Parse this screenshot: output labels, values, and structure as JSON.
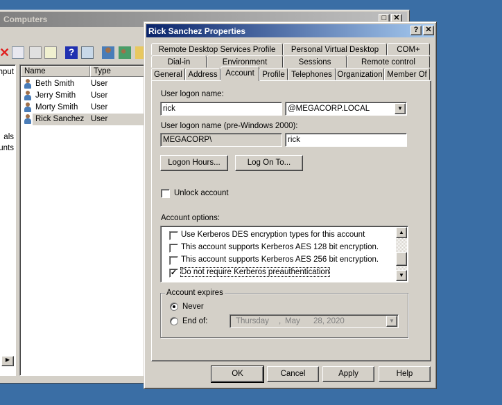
{
  "background_window": {
    "title": "Computers",
    "tree_items": [
      "nput",
      "als",
      "unts"
    ],
    "list_headers": [
      "Name",
      "Type"
    ],
    "rows": [
      {
        "name": "Beth Smith",
        "type": "User"
      },
      {
        "name": "Jerry Smith",
        "type": "User"
      },
      {
        "name": "Morty Smith",
        "type": "User"
      },
      {
        "name": "Rick Sanchez",
        "type": "User",
        "selected": true
      }
    ],
    "toolbar_icons": [
      "delete-icon",
      "properties-icon",
      "refresh-icon",
      "export-icon",
      "help-icon",
      "console-icon",
      "new-user-icon",
      "new-group-icon",
      "new-ou-icon"
    ]
  },
  "dialog": {
    "title": "Rick Sanchez Properties",
    "help_label": "?",
    "close_label": "✕",
    "tabs_row1": [
      "Remote Desktop Services Profile",
      "Personal Virtual Desktop",
      "COM+"
    ],
    "tabs_row2": [
      "Dial-in",
      "Environment",
      "Sessions",
      "Remote control"
    ],
    "tabs_row3": [
      "General",
      "Address",
      "Account",
      "Profile",
      "Telephones",
      "Organization",
      "Member Of"
    ],
    "active_tab": "Account",
    "account": {
      "logon_name_label": "User logon name:",
      "logon_name": "rick",
      "domain": "@MEGACORP.LOCAL",
      "pre2000_label": "User logon name (pre-Windows 2000):",
      "pre2000_domain": "MEGACORP\\",
      "pre2000_name": "rick",
      "logon_hours_btn": "Logon Hours...",
      "log_on_to_btn": "Log On To...",
      "unlock_label": "Unlock account",
      "unlock_checked": false,
      "options_label": "Account options:",
      "options": [
        {
          "label": "Use Kerberos DES encryption types for this account",
          "checked": false
        },
        {
          "label": "This account supports Kerberos AES 128 bit encryption.",
          "checked": false
        },
        {
          "label": "This account supports Kerberos AES 256 bit encryption.",
          "checked": false
        },
        {
          "label": "Do not require Kerberos preauthentication",
          "checked": true
        }
      ],
      "expires_label": "Account expires",
      "never_label": "Never",
      "end_of_label": "End of:",
      "expires_selected": "Never",
      "date_weekday": "Thursday",
      "date_sep": ",",
      "date_month": "May",
      "date_dayyear": "28, 2020"
    },
    "buttons": {
      "ok": "OK",
      "cancel": "Cancel",
      "apply": "Apply",
      "help": "Help"
    }
  }
}
